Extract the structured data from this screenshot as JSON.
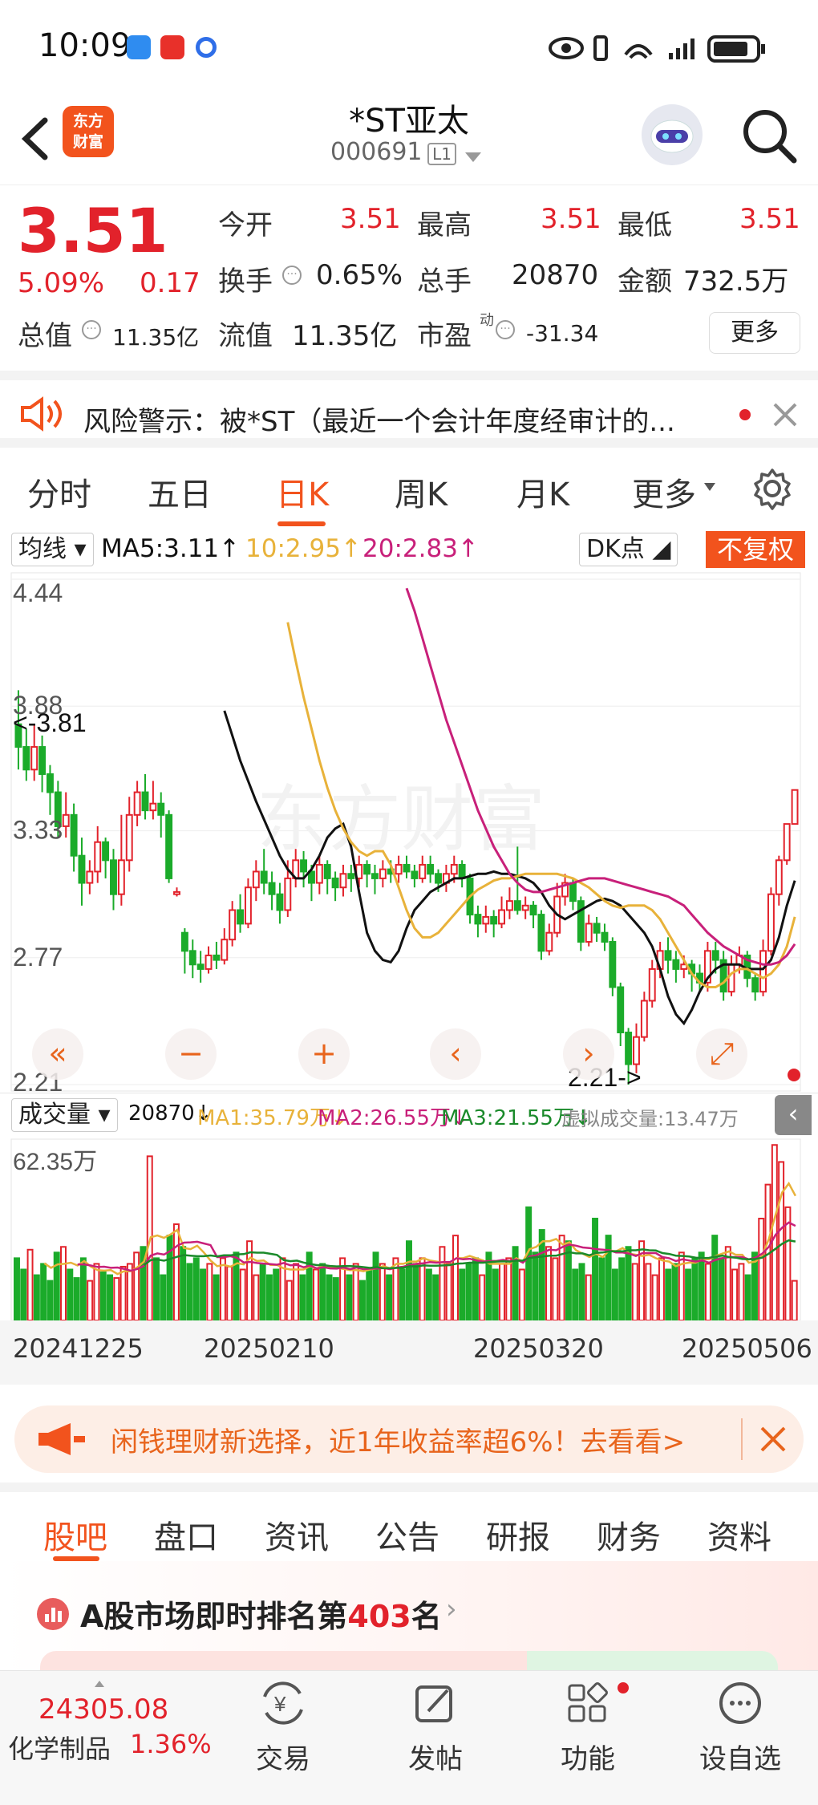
{
  "status": {
    "time": "10:09"
  },
  "header": {
    "title": "*ST亚太",
    "code": "000691",
    "level": "L1",
    "logo_text": "东方\n财富"
  },
  "quote": {
    "price": "3.51",
    "change_pct": "5.09%",
    "change": "0.17",
    "open_label": "今开",
    "open": "3.51",
    "high_label": "最高",
    "high": "3.51",
    "low_label": "最低",
    "low": "3.51",
    "turnover_label": "换手",
    "turnover": "0.65%",
    "volume_label": "总手",
    "volume": "20870",
    "amount_label": "金额",
    "amount": "732.5万",
    "mktcap_label": "总值",
    "mktcap": "11.35亿",
    "float_label": "流值",
    "float": "11.35亿",
    "pe_label": "市盈",
    "pe_sup": "动",
    "pe": "-31.34",
    "more": "更多"
  },
  "risk": {
    "text": "风险警示：被*ST（最近一个会计年度经审计的..."
  },
  "period_tabs": [
    "分时",
    "五日",
    "日K",
    "周K",
    "月K",
    "更多"
  ],
  "indicator": {
    "ma_select": "均线",
    "ma5": "MA5:3.11",
    "ma10": "10:2.95",
    "ma20": "20:2.83",
    "dk": "DK点",
    "fq": "不复权"
  },
  "chart_data": {
    "type": "candlestick",
    "price_axis": {
      "labels": [
        "4.44",
        "3.88",
        "3.33",
        "2.77",
        "2.21"
      ],
      "ylim": [
        2.21,
        4.44
      ]
    },
    "annotations": {
      "high_marker": "<-3.81",
      "low_marker": "2.21->"
    },
    "dates": [
      "20241225",
      "20250210",
      "20250320",
      "20250506"
    ],
    "candles": [
      [
        3.8,
        3.7,
        3.95,
        3.6
      ],
      [
        3.7,
        3.6,
        3.78,
        3.55
      ],
      [
        3.6,
        3.7,
        3.8,
        3.55
      ],
      [
        3.7,
        3.58,
        3.75,
        3.5
      ],
      [
        3.58,
        3.5,
        3.62,
        3.4
      ],
      [
        3.5,
        3.35,
        3.55,
        3.3
      ],
      [
        3.35,
        3.4,
        3.5,
        3.3
      ],
      [
        3.4,
        3.22,
        3.45,
        3.15
      ],
      [
        3.22,
        3.1,
        3.3,
        3.0
      ],
      [
        3.1,
        3.15,
        3.2,
        3.05
      ],
      [
        3.15,
        3.28,
        3.35,
        3.1
      ],
      [
        3.28,
        3.2,
        3.3,
        3.12
      ],
      [
        3.2,
        3.05,
        3.25,
        2.98
      ],
      [
        3.05,
        3.2,
        3.4,
        3.0
      ],
      [
        3.2,
        3.4,
        3.48,
        3.15
      ],
      [
        3.4,
        3.5,
        3.55,
        3.35
      ],
      [
        3.5,
        3.42,
        3.58,
        3.38
      ],
      [
        3.42,
        3.45,
        3.55,
        3.38
      ],
      [
        3.45,
        3.4,
        3.5,
        3.3
      ],
      [
        3.4,
        3.12,
        3.42,
        3.1
      ],
      [
        3.05,
        3.06,
        3.08,
        3.04
      ],
      [
        2.88,
        2.8,
        2.9,
        2.7
      ],
      [
        2.8,
        2.74,
        2.85,
        2.68
      ],
      [
        2.74,
        2.72,
        2.8,
        2.66
      ],
      [
        2.72,
        2.78,
        2.82,
        2.7
      ],
      [
        2.78,
        2.76,
        2.84,
        2.72
      ],
      [
        2.76,
        2.85,
        2.9,
        2.74
      ],
      [
        2.85,
        2.98,
        3.02,
        2.82
      ],
      [
        2.98,
        2.92,
        3.05,
        2.88
      ],
      [
        2.92,
        3.08,
        3.12,
        2.9
      ],
      [
        3.08,
        3.15,
        3.2,
        3.02
      ],
      [
        3.15,
        3.1,
        3.25,
        3.05
      ],
      [
        3.1,
        3.05,
        3.15,
        2.98
      ],
      [
        3.05,
        2.98,
        3.1,
        2.92
      ],
      [
        2.98,
        3.12,
        3.2,
        2.95
      ],
      [
        3.12,
        3.2,
        3.25,
        3.08
      ],
      [
        3.2,
        3.15,
        3.24,
        3.08
      ],
      [
        3.15,
        3.1,
        3.18,
        3.02
      ],
      [
        3.1,
        3.18,
        3.22,
        3.05
      ],
      [
        3.18,
        3.12,
        3.2,
        3.05
      ],
      [
        3.12,
        3.08,
        3.15,
        3.02
      ],
      [
        3.08,
        3.14,
        3.18,
        3.04
      ],
      [
        3.14,
        3.12,
        3.18,
        3.06
      ],
      [
        3.12,
        3.18,
        3.22,
        3.08
      ],
      [
        3.18,
        3.14,
        3.2,
        3.08
      ],
      [
        3.14,
        3.12,
        3.18,
        3.05
      ],
      [
        3.12,
        3.16,
        3.2,
        3.08
      ],
      [
        3.16,
        3.14,
        3.2,
        3.1
      ],
      [
        3.14,
        3.18,
        3.22,
        3.1
      ],
      [
        3.18,
        3.15,
        3.22,
        3.12
      ],
      [
        3.15,
        3.12,
        3.18,
        3.08
      ],
      [
        3.12,
        3.18,
        3.22,
        3.1
      ],
      [
        3.18,
        3.14,
        3.22,
        3.1
      ],
      [
        3.14,
        3.1,
        3.16,
        3.06
      ],
      [
        3.1,
        3.14,
        3.18,
        3.06
      ],
      [
        3.14,
        3.18,
        3.22,
        3.1
      ],
      [
        3.18,
        3.12,
        3.2,
        3.08
      ],
      [
        3.12,
        2.96,
        3.14,
        2.92
      ],
      [
        2.96,
        2.92,
        3.0,
        2.86
      ],
      [
        2.92,
        2.95,
        3.0,
        2.88
      ],
      [
        2.95,
        2.92,
        2.98,
        2.86
      ],
      [
        2.92,
        2.98,
        3.04,
        2.9
      ],
      [
        2.98,
        3.02,
        3.08,
        2.94
      ],
      [
        3.02,
        2.98,
        3.26,
        2.96
      ],
      [
        2.98,
        3.0,
        3.04,
        2.94
      ],
      [
        3.0,
        2.96,
        3.02,
        2.9
      ],
      [
        2.96,
        2.8,
        2.98,
        2.76
      ],
      [
        2.8,
        2.88,
        2.92,
        2.78
      ],
      [
        2.88,
        3.04,
        3.1,
        2.86
      ],
      [
        3.04,
        3.1,
        3.14,
        3.0
      ],
      [
        3.1,
        3.02,
        3.12,
        2.98
      ],
      [
        3.02,
        2.84,
        3.04,
        2.8
      ],
      [
        2.84,
        2.92,
        2.96,
        2.82
      ],
      [
        2.92,
        2.88,
        2.95,
        2.84
      ],
      [
        2.88,
        2.84,
        2.92,
        2.8
      ],
      [
        2.84,
        2.64,
        2.86,
        2.6
      ],
      [
        2.64,
        2.44,
        2.66,
        2.38
      ],
      [
        2.44,
        2.3,
        2.46,
        2.21
      ],
      [
        2.3,
        2.42,
        2.48,
        2.26
      ],
      [
        2.42,
        2.58,
        2.62,
        2.4
      ],
      [
        2.58,
        2.72,
        2.76,
        2.55
      ],
      [
        2.72,
        2.8,
        2.84,
        2.68
      ],
      [
        2.8,
        2.76,
        2.86,
        2.7
      ],
      [
        2.76,
        2.72,
        2.8,
        2.66
      ],
      [
        2.72,
        2.74,
        2.78,
        2.68
      ],
      [
        2.74,
        2.7,
        2.76,
        2.62
      ],
      [
        2.7,
        2.66,
        2.74,
        2.62
      ],
      [
        2.66,
        2.8,
        2.84,
        2.62
      ],
      [
        2.8,
        2.76,
        2.84,
        2.7
      ],
      [
        2.76,
        2.62,
        2.8,
        2.58
      ],
      [
        2.62,
        2.74,
        2.78,
        2.6
      ],
      [
        2.74,
        2.78,
        2.82,
        2.7
      ],
      [
        2.78,
        2.68,
        2.8,
        2.64
      ],
      [
        2.68,
        2.62,
        2.7,
        2.58
      ],
      [
        2.62,
        2.8,
        2.85,
        2.6
      ],
      [
        2.8,
        3.05,
        3.08,
        2.78
      ],
      [
        3.05,
        3.2,
        3.22,
        3.0
      ],
      [
        3.2,
        3.36,
        3.36,
        3.18
      ],
      [
        3.36,
        3.51,
        3.51,
        3.51
      ]
    ],
    "ma_series": [
      {
        "name": "MA5",
        "color": "#111111",
        "values": [
          3.86,
          3.75,
          3.64,
          3.55,
          3.46,
          3.38,
          3.3,
          3.22,
          3.16,
          3.12,
          3.12,
          3.16,
          3.22,
          3.3,
          3.34,
          3.36,
          3.26,
          3.06,
          2.88,
          2.8,
          2.76,
          2.75,
          2.8,
          2.9,
          2.98,
          3.02,
          3.06,
          3.08,
          3.1,
          3.12,
          3.12,
          3.13,
          3.14,
          3.14,
          3.15,
          3.14,
          3.14,
          3.13,
          3.12,
          3.1,
          3.06,
          3.0,
          2.96,
          2.94,
          2.96,
          2.98,
          3.0,
          3.02,
          3.03,
          3.02,
          3.0,
          2.96,
          2.92,
          2.88,
          2.82,
          2.72,
          2.6,
          2.52,
          2.48,
          2.54,
          2.62,
          2.68,
          2.72,
          2.74,
          2.74,
          2.74,
          2.72,
          2.72,
          2.72,
          2.76,
          2.86,
          3.0,
          3.11
        ]
      },
      {
        "name": "MA10",
        "color": "#e8b23a",
        "values": [
          4.25,
          4.08,
          3.92,
          3.78,
          3.64,
          3.52,
          3.42,
          3.34,
          3.28,
          3.24,
          3.22,
          3.24,
          3.24,
          3.18,
          3.08,
          2.98,
          2.9,
          2.86,
          2.86,
          2.88,
          2.92,
          2.96,
          3.0,
          3.04,
          3.07,
          3.09,
          3.11,
          3.12,
          3.12,
          3.13,
          3.14,
          3.14,
          3.14,
          3.14,
          3.14,
          3.13,
          3.12,
          3.1,
          3.08,
          3.05,
          3.02,
          3.0,
          2.99,
          3.0,
          3.0,
          3.0,
          2.98,
          2.94,
          2.88,
          2.82,
          2.76,
          2.7,
          2.66,
          2.64,
          2.64,
          2.66,
          2.7,
          2.72,
          2.72,
          2.7,
          2.68,
          2.7,
          2.74,
          2.82,
          2.95
        ]
      },
      {
        "name": "MA20",
        "color": "#c8207a",
        "values": [
          4.4,
          4.3,
          4.18,
          4.06,
          3.94,
          3.82,
          3.72,
          3.62,
          3.52,
          3.42,
          3.34,
          3.26,
          3.2,
          3.14,
          3.1,
          3.07,
          3.06,
          3.06,
          3.07,
          3.08,
          3.09,
          3.1,
          3.11,
          3.12,
          3.12,
          3.12,
          3.11,
          3.1,
          3.09,
          3.08,
          3.07,
          3.06,
          3.05,
          3.04,
          3.02,
          3.0,
          2.96,
          2.92,
          2.88,
          2.85,
          2.82,
          2.8,
          2.78,
          2.76,
          2.75,
          2.74,
          2.74,
          2.75,
          2.78,
          2.83
        ]
      }
    ],
    "volume": {
      "select": "成交量",
      "value": "20870",
      "ma1": "MA1:35.79万",
      "ma2": "MA2:26.55万",
      "ma3": "MA3:21.55万",
      "virtual": "虚拟成交量:13.47万",
      "max_label": "62.35万",
      "ylim": [
        0,
        62.35
      ],
      "bars": [
        22,
        18,
        25,
        16,
        20,
        14,
        24,
        26,
        18,
        15,
        22,
        14,
        20,
        17,
        16,
        15,
        19,
        20,
        24,
        26,
        58,
        22,
        16,
        30,
        34,
        26,
        20,
        22,
        18,
        20,
        16,
        22,
        19,
        24,
        18,
        28,
        16,
        20,
        16,
        18,
        22,
        14,
        20,
        16,
        24,
        18,
        20,
        16,
        15,
        22,
        16,
        20,
        14,
        18,
        24,
        20,
        16,
        22,
        18,
        28,
        20,
        22,
        18,
        16,
        26,
        20,
        30,
        18,
        20,
        22,
        16,
        24,
        18,
        20,
        22,
        26,
        18,
        40,
        24,
        32,
        26,
        22,
        30,
        28,
        18,
        20,
        16,
        36,
        22,
        30,
        18,
        22,
        26,
        20,
        28,
        20,
        16,
        22,
        18,
        20,
        24,
        18,
        22,
        24,
        20,
        30,
        22,
        26,
        18,
        20,
        16,
        24,
        36,
        48,
        62,
        56,
        40,
        14
      ]
    }
  },
  "chart_buttons": [
    "«",
    "−",
    "+",
    "‹",
    "›",
    "⤢"
  ],
  "promo": {
    "text": "闲钱理财新选择，近1年收益率超6%！去看看>"
  },
  "section_tabs": [
    "股吧",
    "盘口",
    "资讯",
    "公告",
    "研报",
    "财务",
    "资料"
  ],
  "rank": {
    "prefix": "A股市场即时排名第",
    "number": "403",
    "suffix": "名"
  },
  "bottom_nav": {
    "index_value": "24305.08",
    "index_name": "化学制品",
    "index_change": "1.36%",
    "items": [
      "交易",
      "发帖",
      "功能",
      "设自选"
    ]
  },
  "colors": {
    "up": "#e2222b",
    "down": "#1bab2a",
    "accent": "#f2531d"
  }
}
